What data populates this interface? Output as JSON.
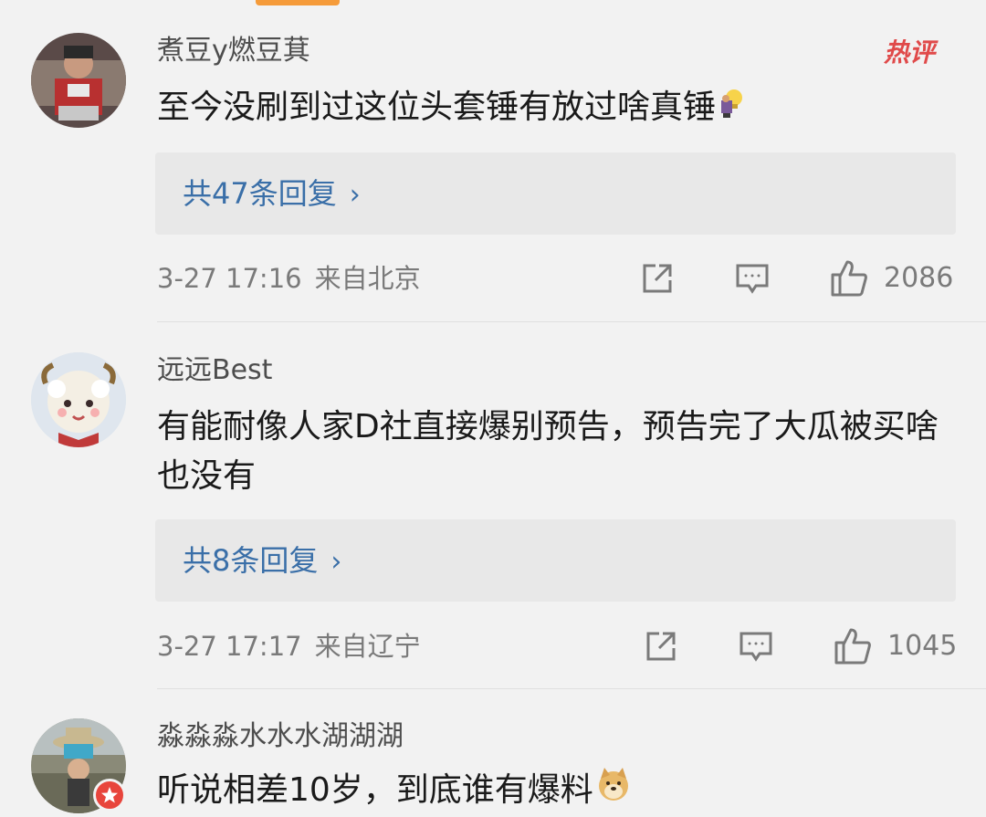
{
  "comments": [
    {
      "username": "煮豆y燃豆萁",
      "badge": "热评",
      "text": "至今没刷到过这位头套锤有放过啥真锤",
      "emoji": "lightbulb-emoji",
      "replies_label": "共47条回复",
      "date": "3-27 17:16",
      "location": "来自北京",
      "likes": "2086"
    },
    {
      "username": "远远Best",
      "text": "有能耐像人家D社直接爆别预告，预告完了大瓜被买啥也没有",
      "replies_label": "共8条回复",
      "date": "3-27 17:17",
      "location": "来自辽宁",
      "likes": "1045"
    },
    {
      "username": "淼淼淼水水水湖湖湖",
      "text": "听说相差10岁，到底谁有爆料",
      "emoji": "doge-emoji"
    }
  ],
  "colors": {
    "background": "#f2f2f2",
    "reply_link": "#3a6fa8",
    "hot_badge": "#e04a4a",
    "meta_text": "#7a7a7a"
  }
}
